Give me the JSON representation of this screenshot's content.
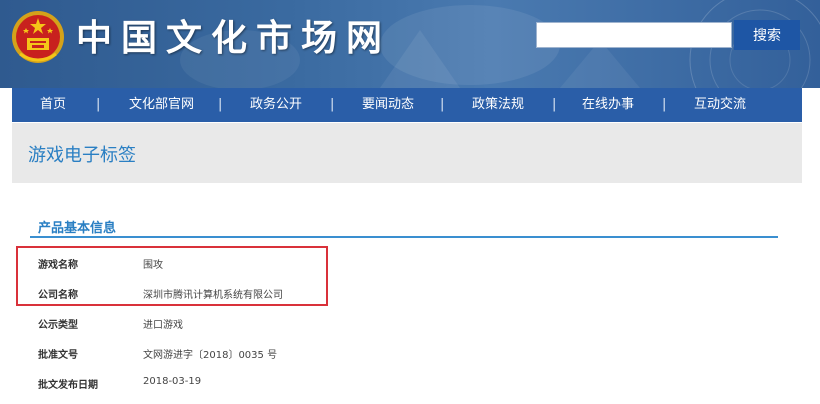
{
  "header": {
    "site_title": "中国文化市场网",
    "search": {
      "button_label": "搜索",
      "value": ""
    }
  },
  "nav": {
    "items": [
      "首页",
      "文化部官网",
      "政务公开",
      "要闻动态",
      "政策法规",
      "在线办事",
      "互动交流"
    ],
    "separator": "|"
  },
  "page": {
    "title": "游戏电子标签"
  },
  "section": {
    "heading": "产品基本信息",
    "rows": [
      {
        "label": "游戏名称",
        "value": "围攻"
      },
      {
        "label": "公司名称",
        "value": "深圳市腾讯计算机系统有限公司"
      },
      {
        "label": "公示类型",
        "value": "进口游戏"
      },
      {
        "label": "批准文号",
        "value": "文网游进字〔2018〕0035 号"
      },
      {
        "label": "批文发布日期",
        "value": "2018-03-19"
      }
    ]
  },
  "colors": {
    "banner": "#3a6aa0",
    "nav": "#2a5ea8",
    "accent": "#2a7fc3",
    "highlight": "#d9313a"
  }
}
